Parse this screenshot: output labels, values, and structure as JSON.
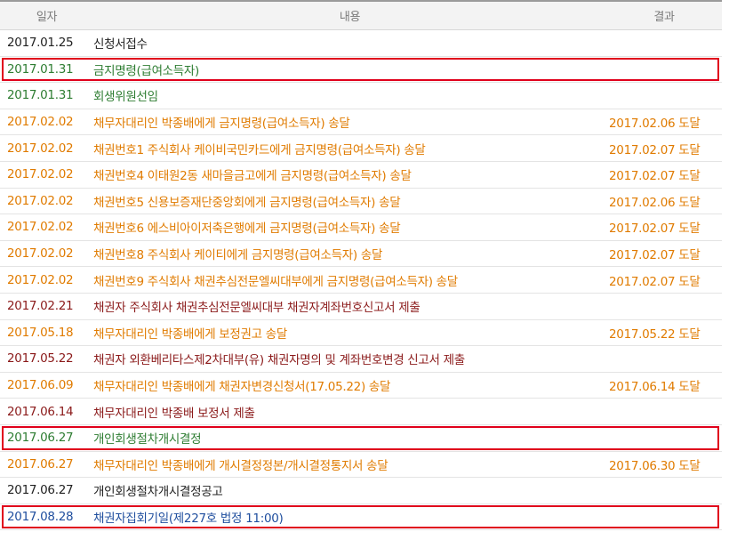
{
  "headers": {
    "date": "일자",
    "content": "내용",
    "result": "결과"
  },
  "colors": {
    "black": "#222222",
    "green": "#2e7d32",
    "orange": "#e07b00",
    "maroon": "#8b1a1a",
    "blue": "#1f4e9e",
    "highlight_border": "#e0001b"
  },
  "rows": [
    {
      "date": "2017.01.25",
      "content": "신청서접수",
      "result": "",
      "color": "black",
      "highlight": false
    },
    {
      "date": "2017.01.31",
      "content": "금지명령(급여소득자)",
      "result": "",
      "color": "green",
      "highlight": true
    },
    {
      "date": "2017.01.31",
      "content": "회생위원선임",
      "result": "",
      "color": "green",
      "highlight": false
    },
    {
      "date": "2017.02.02",
      "content": "채무자대리인 박종배에게 금지명령(급여소득자) 송달",
      "result": "2017.02.06 도달",
      "color": "orange",
      "highlight": false
    },
    {
      "date": "2017.02.02",
      "content": "채권번호1 주식회사 케이비국민카드에게 금지명령(급여소득자) 송달",
      "result": "2017.02.07 도달",
      "color": "orange",
      "highlight": false
    },
    {
      "date": "2017.02.02",
      "content": "채권번호4 이태원2동 새마을금고에게 금지명령(급여소득자) 송달",
      "result": "2017.02.07 도달",
      "color": "orange",
      "highlight": false
    },
    {
      "date": "2017.02.02",
      "content": "채권번호5 신용보증재단중앙회에게 금지명령(급여소득자) 송달",
      "result": "2017.02.06 도달",
      "color": "orange",
      "highlight": false
    },
    {
      "date": "2017.02.02",
      "content": "채권번호6 에스비아이저축은행에게 금지명령(급여소득자) 송달",
      "result": "2017.02.07 도달",
      "color": "orange",
      "highlight": false
    },
    {
      "date": "2017.02.02",
      "content": "채권번호8 주식회사 케이티에게 금지명령(급여소득자) 송달",
      "result": "2017.02.07 도달",
      "color": "orange",
      "highlight": false
    },
    {
      "date": "2017.02.02",
      "content": "채권번호9 주식회사 채권추심전문엘씨대부에게 금지명령(급여소득자) 송달",
      "result": "2017.02.07 도달",
      "color": "orange",
      "highlight": false
    },
    {
      "date": "2017.02.21",
      "content": "채권자 주식회사 채권추심전문엘씨대부 채권자계좌번호신고서 제출",
      "result": "",
      "color": "maroon",
      "highlight": false
    },
    {
      "date": "2017.05.18",
      "content": "채무자대리인 박종배에게 보정권고 송달",
      "result": "2017.05.22 도달",
      "color": "orange",
      "highlight": false
    },
    {
      "date": "2017.05.22",
      "content": "채권자 외환베리타스제2차대부(유) 채권자명의 및 계좌번호변경 신고서 제출",
      "result": "",
      "color": "maroon",
      "highlight": false
    },
    {
      "date": "2017.06.09",
      "content": "채무자대리인 박종배에게 채권자변경신청서(17.05.22) 송달",
      "result": "2017.06.14 도달",
      "color": "orange",
      "highlight": false
    },
    {
      "date": "2017.06.14",
      "content": "채무자대리인 박종배 보정서 제출",
      "result": "",
      "color": "maroon",
      "highlight": false
    },
    {
      "date": "2017.06.27",
      "content": "개인회생절차개시결정",
      "result": "",
      "color": "green",
      "highlight": true
    },
    {
      "date": "2017.06.27",
      "content": "채무자대리인 박종배에게 개시결정정본/개시결정통지서 송달",
      "result": "2017.06.30 도달",
      "color": "orange",
      "highlight": false
    },
    {
      "date": "2017.06.27",
      "content": "개인회생절차개시결정공고",
      "result": "",
      "color": "black",
      "highlight": false
    },
    {
      "date": "2017.08.28",
      "content": "채권자집회기일(제227호 법정 11:00)",
      "result": "",
      "color": "blue",
      "highlight": true
    }
  ]
}
